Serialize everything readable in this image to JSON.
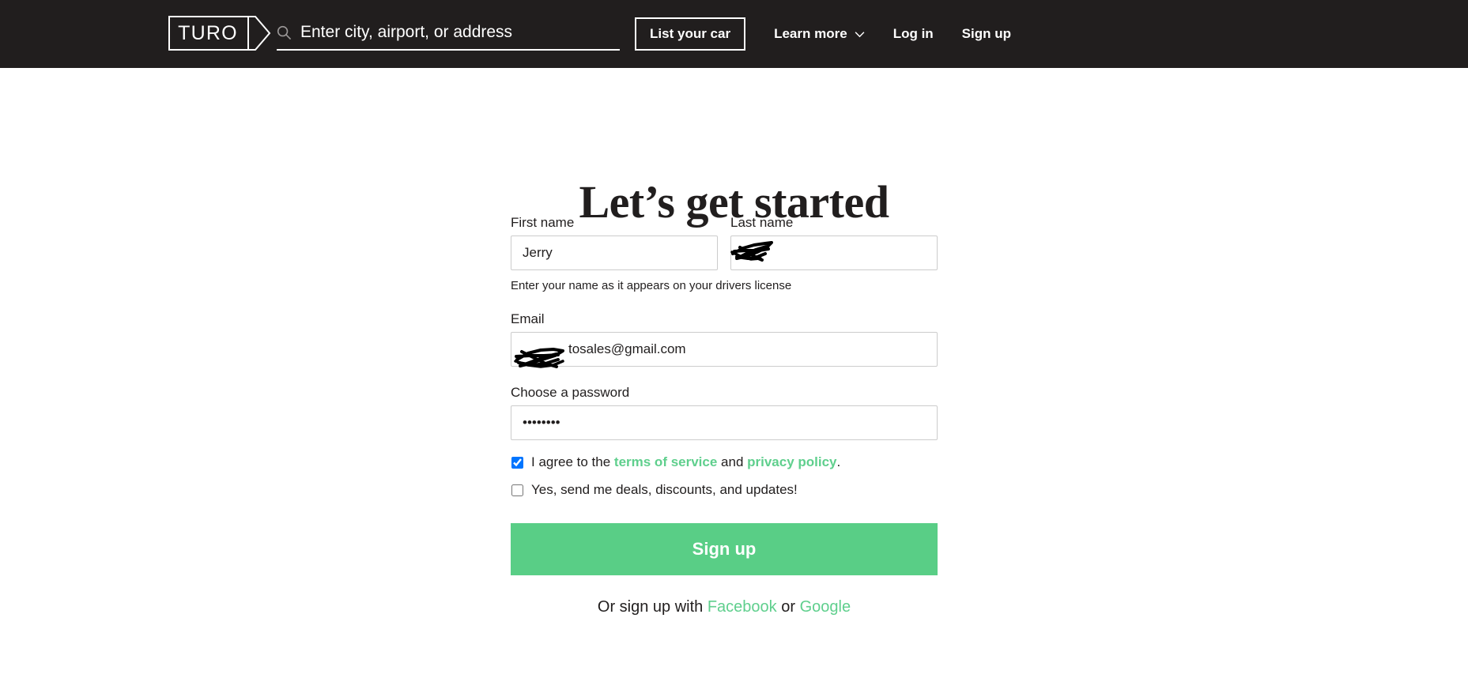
{
  "nav": {
    "logo_text": "TURO",
    "search": {
      "placeholder": "Enter city, airport, or address",
      "value": "",
      "icon": "search-icon"
    },
    "list_your_car": "List your car",
    "learn_more": "Learn more",
    "learn_more_icon": "chevron-down-icon",
    "log_in": "Log in",
    "sign_up": "Sign up"
  },
  "main": {
    "title": "Let’s get started",
    "first_name": {
      "label": "First name",
      "value": "Jerry"
    },
    "last_name": {
      "label": "Last name",
      "value": "",
      "redacted": true
    },
    "name_helper": "Enter your name as it appears on your drivers license",
    "email": {
      "label": "Email",
      "value": "tosales@gmail.com",
      "redacted_prefix": true
    },
    "password": {
      "label": "Choose a password",
      "value": "••••••••"
    },
    "terms": {
      "checked": true,
      "prefix": "I agree to the ",
      "terms_link": "terms of service",
      "middle": " and ",
      "privacy_link": "privacy policy",
      "suffix": "."
    },
    "deals": {
      "checked": false,
      "label": "Yes, send me deals, discounts, and updates!"
    },
    "submit_label": "Sign up",
    "social": {
      "prefix": "Or sign up with ",
      "facebook": "Facebook",
      "middle": " or ",
      "google": "Google"
    }
  },
  "colors": {
    "nav_bg": "#211E1E",
    "accent_green": "#59CE86",
    "link_green": "#5FCF8D",
    "text": "#211E1E",
    "input_border": "#CCCCCC"
  }
}
